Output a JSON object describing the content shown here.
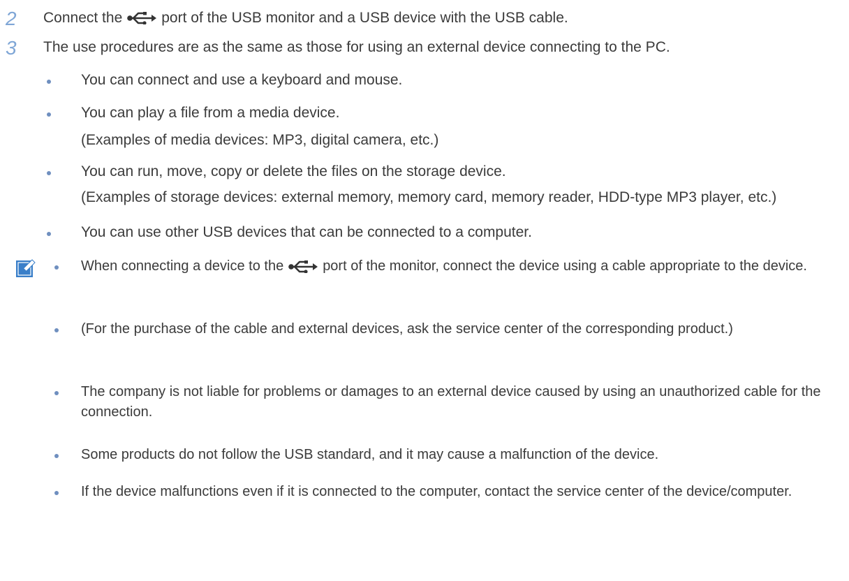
{
  "steps": [
    {
      "num": "2",
      "before": "Connect the",
      "after": "port of the USB monitor and a USB device with the USB cable."
    },
    {
      "num": "3",
      "text": "The use procedures are as the same as those for using an external device connecting to the PC."
    }
  ],
  "bullets": [
    {
      "text": "You can connect and use a keyboard and mouse."
    },
    {
      "text": "You can play a file from a media device.",
      "sub": "(Examples of media devices: MP3, digital camera, etc.)"
    },
    {
      "text": "You can run, move, copy or delete the files on the storage device.",
      "sub": "(Examples of storage devices: external memory, memory card, memory reader, HDD-type MP3 player, etc.)"
    },
    {
      "text": "You can use other USB devices that can be connected to a computer."
    }
  ],
  "notes": [
    {
      "before": "When connecting a device to the",
      "after": "port of the monitor, connect the device using a cable appropriate to the device."
    },
    {
      "text": "(For the purchase of the cable and external devices, ask the service center of the corresponding product.)"
    },
    {
      "text": "The company is not liable for problems or damages to an external device caused by using an unauthorized cable for the connection."
    },
    {
      "text": "Some products do not follow the USB standard, and it may cause a malfunction of the device."
    },
    {
      "text": "If the device malfunctions even if it is connected to the computer, contact the service center of the device/computer."
    }
  ],
  "icons": {
    "usb": "usb-icon",
    "note": "note-pencil-icon"
  },
  "colors": {
    "step_number": "#7fa6d6",
    "bullet": "#6f8fbf",
    "note_icon": "#3a7fc9"
  }
}
